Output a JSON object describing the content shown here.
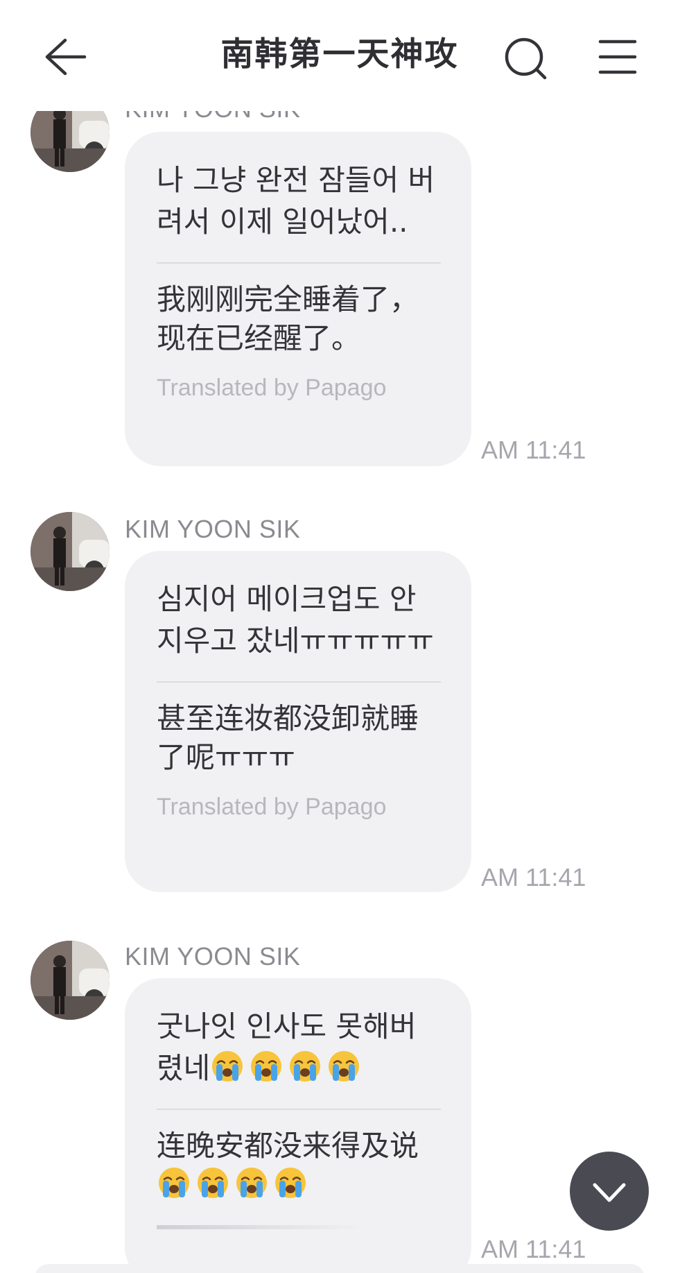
{
  "header": {
    "title": "南韩第一天神攻",
    "back_icon": "arrow-left-icon",
    "search_icon": "search-icon",
    "menu_icon": "hamburger-menu-icon"
  },
  "messages": [
    {
      "sender": "KIM YOON SIK",
      "original": "나 그냥 완전 잠들어 버려서 이제 일어났어..",
      "translated": "我刚刚完全睡着了，现在已经醒了。",
      "credit": "Translated by Papago",
      "time": "AM 11:41"
    },
    {
      "sender": "KIM YOON SIK",
      "original": "심지어 메이크업도 안 지우고 잤네ㅠㅠㅠㅠㅠ",
      "translated": "甚至连妆都没卸就睡了呢ㅠㅠㅠ",
      "credit": "Translated by Papago",
      "time": "AM 11:41"
    },
    {
      "sender": "KIM YOON SIK",
      "original": "굿나잇 인사도 못해버렸네",
      "original_emoji_count": 4,
      "translated": "连晚安都没来得及说",
      "translated_emoji_count": 4,
      "emoji_icon": "loudly-crying-face-icon",
      "time": "AM 11:41"
    }
  ],
  "scroll_button_icon": "chevron-down-icon",
  "colors": {
    "bubble": "#f1f1f3",
    "text": "#333338",
    "meta": "#a6a6ad",
    "scroll_button": "#4a4a52"
  }
}
